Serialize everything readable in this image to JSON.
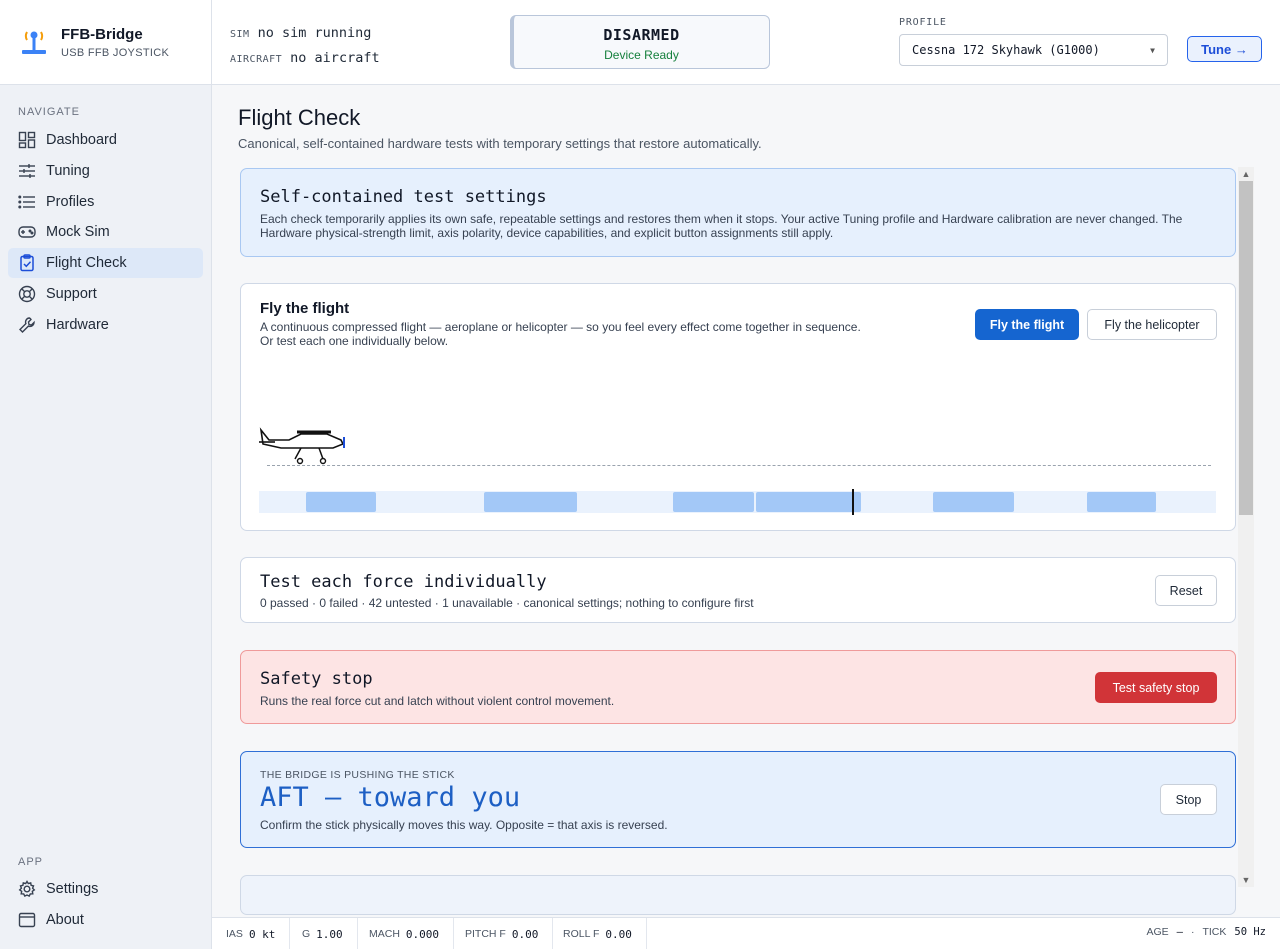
{
  "brand": {
    "name": "FFB-Bridge",
    "subtitle": "USB FFB JOYSTICK"
  },
  "sidebar": {
    "navigate_label": "NAVIGATE",
    "items": [
      {
        "label": "Dashboard",
        "icon": "grid-icon"
      },
      {
        "label": "Tuning",
        "icon": "sliders-icon"
      },
      {
        "label": "Profiles",
        "icon": "list-icon"
      },
      {
        "label": "Mock Sim",
        "icon": "gamepad-icon"
      },
      {
        "label": "Flight Check",
        "icon": "clipboard-check-icon",
        "active": true
      },
      {
        "label": "Support",
        "icon": "lifebuoy-icon"
      },
      {
        "label": "Hardware",
        "icon": "wrench-icon"
      }
    ],
    "app_label": "APP",
    "app_items": [
      {
        "label": "Settings",
        "icon": "gear-icon"
      },
      {
        "label": "About",
        "icon": "window-icon"
      }
    ]
  },
  "header": {
    "sim_key": "SIM",
    "sim_value": "no sim running",
    "aircraft_key": "AIRCRAFT",
    "aircraft_value": "no aircraft",
    "status_title": "DISARMED",
    "status_sub": "Device Ready",
    "profile_label": "PROFILE",
    "profile_value": "Cessna 172 Skyhawk (G1000)",
    "tune_label": "Tune →"
  },
  "main": {
    "title": "Flight Check",
    "subtitle": "Canonical, self-contained hardware tests with temporary settings that restore automatically.",
    "settings_card": {
      "title": "Self-contained test settings",
      "text": "Each check temporarily applies its own safe, repeatable settings and restores them when it stops. Your active Tuning profile and Hardware calibration are never changed. The Hardware physical-strength limit, axis polarity, device capabilities, and explicit button assignments still apply."
    },
    "flight_card": {
      "title": "Fly the flight",
      "text1": "A continuous compressed flight — aeroplane or helicopter — so you feel every effect come together in sequence.",
      "text2": "Or test each one individually below.",
      "btn_flight": "Fly the flight",
      "btn_heli": "Fly the helicopter"
    },
    "force_card": {
      "title": "Test each force individually",
      "text": "0 passed · 0 failed · 42 untested · 1 unavailable · canonical settings; nothing to configure first",
      "reset": "Reset"
    },
    "safety_card": {
      "title": "Safety stop",
      "text": "Runs the real force cut and latch without violent control movement.",
      "btn": "Test safety stop"
    },
    "push_card": {
      "eyebrow": "THE BRIDGE IS PUSHING THE STICK",
      "title": "AFT — toward you",
      "text": "Confirm the stick physically moves this way. Opposite = that axis is reversed.",
      "stop": "Stop"
    }
  },
  "footer": {
    "ias_k": "IAS",
    "ias_v": "0 kt",
    "g_k": "G",
    "g_v": "1.00",
    "mach_k": "MACH",
    "mach_v": "0.000",
    "pitch_k": "PITCH F",
    "pitch_v": "0.00",
    "roll_k": "ROLL F",
    "roll_v": "0.00",
    "age_k": "AGE",
    "age_v": "—",
    "tick_k": "TICK",
    "tick_v": "50 Hz"
  },
  "colors": {
    "accent": "#1565d0",
    "danger": "#d13438",
    "ok": "#15803d",
    "info_bg": "#e6f0fd",
    "danger_bg": "#fde4e4"
  }
}
